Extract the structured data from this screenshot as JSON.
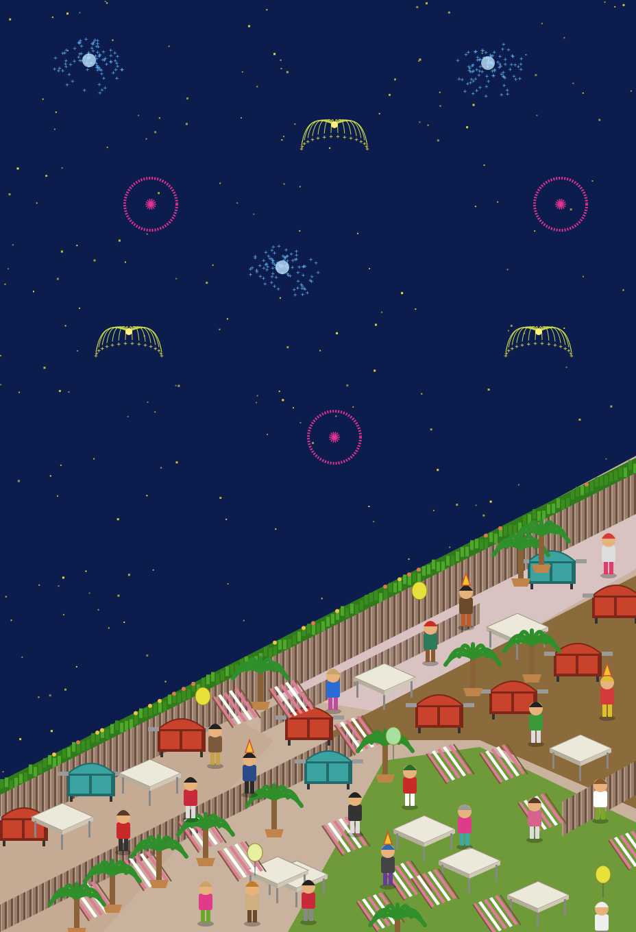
{
  "scene": {
    "title": "",
    "colors": {
      "sky": "#0c1d4d",
      "star": "#f5e23a",
      "firework_blue": "#5aa8e8",
      "firework_yellow": "#f2e447",
      "firework_pink": "#e0338f",
      "hedge": "#3c8f22",
      "fence": "#8a6f5e",
      "path": "#d8c2c2",
      "sand_path": "#c9b39f",
      "lawn": "#6f9a3a",
      "dirt": "#8a6a3c"
    },
    "fireworks": [
      {
        "kind": "spray",
        "color": "blue"
      },
      {
        "kind": "spray",
        "color": "blue"
      },
      {
        "kind": "fountain",
        "color": "yellow"
      },
      {
        "kind": "ring",
        "color": "pink"
      },
      {
        "kind": "ring",
        "color": "pink"
      },
      {
        "kind": "spray",
        "color": "blue"
      },
      {
        "kind": "fountain",
        "color": "yellow"
      },
      {
        "kind": "fountain",
        "color": "yellow"
      },
      {
        "kind": "ring",
        "color": "pink"
      }
    ],
    "props": {
      "grills": [
        "red-grill",
        "teal-grill",
        "red-grill",
        "teal-grill",
        "red-grill",
        "red-grill",
        "red-grill",
        "red-grill",
        "red-grill",
        "teal-grill"
      ],
      "tables": 10,
      "deck_chairs": 16,
      "palm_trees": 12,
      "avatars": 24,
      "balloons": 4,
      "party_hats": 5
    }
  }
}
